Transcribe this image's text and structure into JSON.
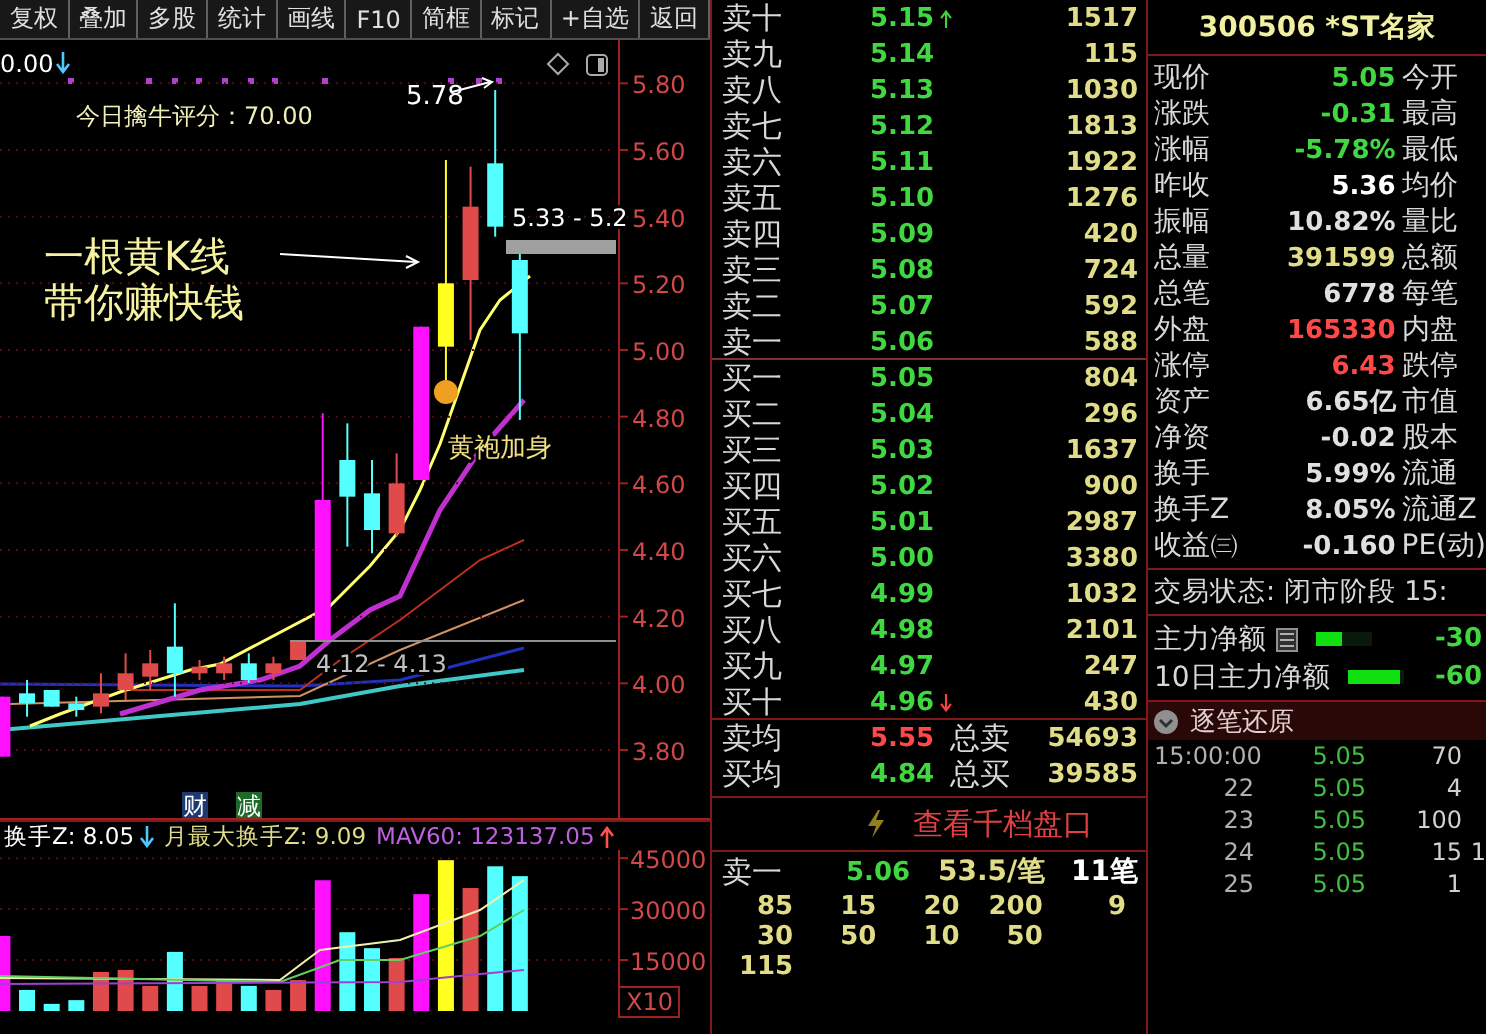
{
  "toolbar": [
    "复权",
    "叠加",
    "多股",
    "统计",
    "画线",
    "F10",
    "简框",
    "标记",
    "+自选",
    "返回"
  ],
  "chart": {
    "reading": {
      "text": "0.00",
      "kind": "down"
    },
    "score": "今日擒牛评分：70.00",
    "peak": "5.78",
    "range": "5.33 - 5.2",
    "slogan": [
      "一根黄K线",
      "带你赚快钱"
    ],
    "base_range": "4.12 - 4.13",
    "chart_data": {
      "type": "candlestick",
      "categories": [
        null,
        null,
        null,
        null,
        null,
        null,
        null,
        null,
        null,
        null,
        null,
        null,
        null,
        null,
        null,
        null,
        null,
        null,
        null,
        null,
        null,
        null
      ],
      "colors": [
        "#ff10ff",
        "#55ffff",
        "#55ffff",
        "#55ffff",
        "#e04a4a",
        "#e04a4a",
        "#e04a4a",
        "#55ffff",
        "#e04a4a",
        "#e04a4a",
        "#55ffff",
        "#e04a4a",
        "#e04a4a",
        "#ff10ff",
        "#55ffff",
        "#55ffff",
        "#e04a4a",
        "#ff10ff",
        "#ffff20",
        "#e04a4a",
        "#55ffff",
        "#55ffff"
      ],
      "ohlc": [
        [
          3.78,
          3.96,
          3.78,
          3.96
        ],
        [
          3.97,
          4.01,
          3.9,
          3.94
        ],
        [
          3.98,
          3.98,
          3.93,
          3.93
        ],
        [
          3.94,
          3.96,
          3.9,
          3.92
        ],
        [
          3.93,
          4.03,
          3.91,
          3.97
        ],
        [
          3.98,
          4.09,
          3.95,
          4.03
        ],
        [
          4.02,
          4.1,
          3.98,
          4.06
        ],
        [
          4.11,
          4.24,
          3.96,
          4.03
        ],
        [
          4.03,
          4.07,
          4.01,
          4.05
        ],
        [
          4.03,
          4.08,
          4.01,
          4.06
        ],
        [
          4.06,
          4.09,
          4.0,
          4.01
        ],
        [
          4.03,
          4.08,
          4.01,
          4.06
        ],
        [
          4.07,
          4.13,
          4.07,
          4.13
        ],
        [
          4.13,
          4.81,
          4.13,
          4.55
        ],
        [
          4.67,
          4.78,
          4.41,
          4.56
        ],
        [
          4.57,
          4.67,
          4.39,
          4.46
        ],
        [
          4.45,
          4.69,
          4.44,
          4.6
        ],
        [
          4.61,
          5.07,
          4.61,
          5.07
        ],
        [
          5.01,
          5.57,
          4.91,
          5.2
        ],
        [
          5.21,
          5.55,
          5.03,
          5.43
        ],
        [
          5.56,
          5.78,
          5.34,
          5.37
        ],
        [
          5.27,
          5.29,
          4.79,
          5.05
        ]
      ],
      "ylim": [
        3.59,
        5.93
      ],
      "grid": true,
      "yticks": [
        {
          "value": 5.8,
          "label": "5.80"
        },
        {
          "value": 5.6,
          "label": "5.60"
        },
        {
          "value": 5.4,
          "label": "5.40"
        },
        {
          "value": 5.2,
          "label": "5.20"
        },
        {
          "value": 5.0,
          "label": "5.00"
        },
        {
          "value": 4.8,
          "label": "4.80"
        },
        {
          "value": 4.6,
          "label": "4.60"
        },
        {
          "value": 4.4,
          "label": "4.40"
        },
        {
          "value": 4.2,
          "label": "4.20"
        },
        {
          "value": 4.0,
          "label": "4.00"
        },
        {
          "value": 3.8,
          "label": "3.80"
        }
      ],
      "annotations": [
        "黄袍加身"
      ]
    },
    "tags": [
      {
        "text": "财",
        "color": "#1c3a70"
      },
      {
        "text": "减",
        "color": "#1d6a2a"
      }
    ]
  },
  "volume": {
    "readings": [
      {
        "text": "换手Z: 8.05",
        "color": "#ffffff",
        "kind": "down"
      },
      {
        "text": "月最大换手Z: 9.09",
        "color": "#e0dc88",
        "kind": "plain"
      },
      {
        "text": "MAV60: 123137.05",
        "color": "#c060e0",
        "kind": "up"
      }
    ],
    "chart_data": {
      "type": "bar",
      "categories": [
        null,
        null,
        null,
        null,
        null,
        null,
        null,
        null,
        null,
        null,
        null,
        null,
        null,
        null,
        null,
        null,
        null,
        null,
        null,
        null,
        null,
        null
      ],
      "values": [
        22100,
        6200,
        2100,
        3200,
        11500,
        12100,
        7400,
        17400,
        7400,
        9100,
        7400,
        6200,
        9100,
        38500,
        23200,
        18500,
        15600,
        34400,
        44400,
        36200,
        42600,
        39700
      ],
      "ylim": [
        0,
        47400
      ],
      "grid": true,
      "yticks": [
        {
          "value": 45000,
          "label": "45000"
        },
        {
          "value": 30000,
          "label": "30000"
        },
        {
          "value": 15000,
          "label": "15000"
        }
      ]
    },
    "scale": "X10"
  },
  "order_book": {
    "asks": [
      {
        "label": "卖十",
        "price": "5.15",
        "volume": "1517",
        "more": true
      },
      {
        "label": "卖九",
        "price": "5.14",
        "volume": "115",
        "more": false
      },
      {
        "label": "卖八",
        "price": "5.13",
        "volume": "1030",
        "more": false
      },
      {
        "label": "卖七",
        "price": "5.12",
        "volume": "1813",
        "more": false
      },
      {
        "label": "卖六",
        "price": "5.11",
        "volume": "1922",
        "more": false
      },
      {
        "label": "卖五",
        "price": "5.10",
        "volume": "1276",
        "more": false
      },
      {
        "label": "卖四",
        "price": "5.09",
        "volume": "420",
        "more": false
      },
      {
        "label": "卖三",
        "price": "5.08",
        "volume": "724",
        "more": false
      },
      {
        "label": "卖二",
        "price": "5.07",
        "volume": "592",
        "more": false
      },
      {
        "label": "卖一",
        "price": "5.06",
        "volume": "588",
        "more": false
      }
    ],
    "bids": [
      {
        "label": "买一",
        "price": "5.05",
        "volume": "804",
        "more": false
      },
      {
        "label": "买二",
        "price": "5.04",
        "volume": "296",
        "more": false
      },
      {
        "label": "买三",
        "price": "5.03",
        "volume": "1637",
        "more": false
      },
      {
        "label": "买四",
        "price": "5.02",
        "volume": "900",
        "more": false
      },
      {
        "label": "买五",
        "price": "5.01",
        "volume": "2987",
        "more": false
      },
      {
        "label": "买六",
        "price": "5.00",
        "volume": "3380",
        "more": false
      },
      {
        "label": "买七",
        "price": "4.99",
        "volume": "1032",
        "more": false
      },
      {
        "label": "买八",
        "price": "4.98",
        "volume": "2101",
        "more": false
      },
      {
        "label": "买九",
        "price": "4.97",
        "volume": "247",
        "more": false
      },
      {
        "label": "买十",
        "price": "4.96",
        "volume": "430",
        "more": true
      }
    ],
    "summary": [
      {
        "label": "卖均",
        "price": "5.55",
        "color": "#ff4848",
        "total_label": "总卖",
        "total": "54693"
      },
      {
        "label": "买均",
        "price": "4.84",
        "color": "#40d840",
        "total_label": "总买",
        "total": "39585"
      }
    ],
    "depth_link": "查看千档盘口",
    "queue": {
      "label": "卖一",
      "price": "5.06",
      "average": "53.5/笔",
      "count": "11笔",
      "orders": [
        [
          "85",
          "15",
          "20",
          "200",
          "9"
        ],
        [
          "30",
          "50",
          "10",
          "50"
        ],
        [
          "115"
        ]
      ]
    }
  },
  "quote": {
    "code": "300506 *ST名家",
    "rows": [
      {
        "label": "现价",
        "value": "5.05",
        "color": "#40d840",
        "label2": "今开"
      },
      {
        "label": "涨跌",
        "value": "-0.31",
        "color": "#40d840",
        "label2": "最高"
      },
      {
        "label": "涨幅",
        "value": "-5.78%",
        "color": "#40d840",
        "label2": "最低"
      },
      {
        "label": "昨收",
        "value": "5.36",
        "color": "#ffffff",
        "label2": "均价"
      },
      {
        "label": "振幅",
        "value": "10.82%",
        "color": "#e0e0e0",
        "label2": "量比"
      },
      {
        "label": "总量",
        "value": "391599",
        "color": "#e0dc88",
        "label2": "总额"
      },
      {
        "label": "总笔",
        "value": "6778",
        "color": "#e0e0e0",
        "label2": "每笔"
      },
      {
        "label": "外盘",
        "value": "165330",
        "color": "#ff4848",
        "label2": "内盘"
      },
      {
        "label": "涨停",
        "value": "6.43",
        "color": "#ff4848",
        "label2": "跌停"
      },
      {
        "label": "资产",
        "value": "6.65亿",
        "color": "#e0e0e0",
        "label2": "市值"
      },
      {
        "label": "净资",
        "value": "-0.02",
        "color": "#e0e0e0",
        "label2": "股本"
      },
      {
        "label": "换手",
        "value": "5.99%",
        "color": "#e0e0e0",
        "label2": "流通"
      },
      {
        "label": "换手Z",
        "value": "8.05%",
        "color": "#e0e0e0",
        "label2": "流通Z"
      },
      {
        "label": "收益㈢",
        "value": "-0.160",
        "color": "#e0e0e0",
        "label2": "PE(动)"
      }
    ],
    "trading_status": "交易状态: 闭市阶段 15:",
    "net_flow": [
      {
        "label": "主力净额",
        "value": "-30",
        "level": 0.45,
        "menu": true
      },
      {
        "label": "10日主力净额",
        "value": "-60",
        "level": 0.95,
        "menu": false
      }
    ],
    "ticks_header": "逐笔还原",
    "ticks": [
      {
        "time": "15:00:00",
        "price": "5.05",
        "volume": "70"
      },
      {
        "time": "22",
        "price": "5.05",
        "volume": "4"
      },
      {
        "time": "23",
        "price": "5.05",
        "volume": "100"
      },
      {
        "time": "24",
        "price": "5.05",
        "volume": "15",
        "extra": "1"
      },
      {
        "time": "25",
        "price": "5.05",
        "volume": "1"
      }
    ]
  }
}
